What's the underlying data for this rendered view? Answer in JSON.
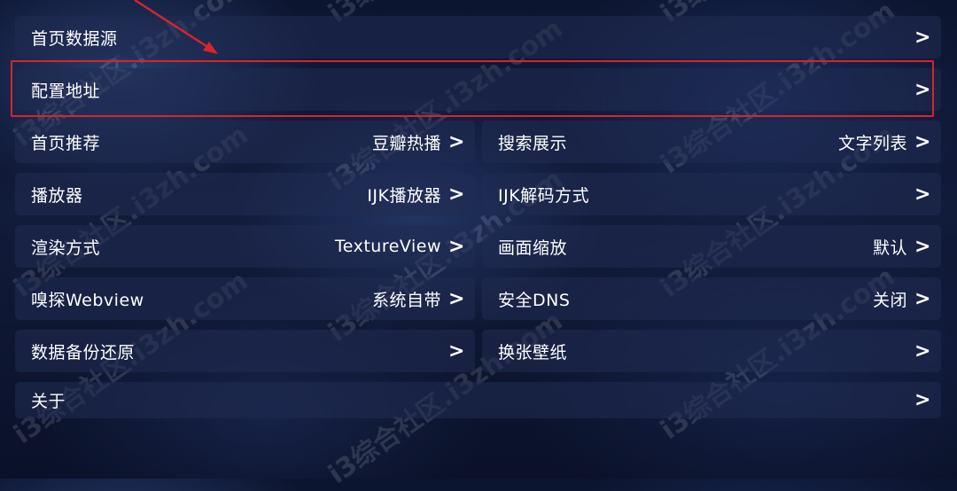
{
  "settings": {
    "rows": [
      {
        "label": "首页数据源",
        "value": "",
        "chevron": ">"
      },
      {
        "label": "配置地址",
        "value": "",
        "chevron": ">"
      }
    ],
    "grid": [
      {
        "label": "首页推荐",
        "value": "豆瓣热播",
        "chevron": ">"
      },
      {
        "label": "搜索展示",
        "value": "文字列表",
        "chevron": ">"
      },
      {
        "label": "播放器",
        "value": "IJK播放器",
        "chevron": ">"
      },
      {
        "label": "IJK解码方式",
        "value": "",
        "chevron": ">"
      },
      {
        "label": "渲染方式",
        "value": "TextureView",
        "chevron": ">"
      },
      {
        "label": "画面缩放",
        "value": "默认",
        "chevron": ">"
      },
      {
        "label": "嗅探Webview",
        "value": "系统自带",
        "chevron": ">"
      },
      {
        "label": "安全DNS",
        "value": "关闭",
        "chevron": ">"
      },
      {
        "label": "数据备份还原",
        "value": "",
        "chevron": ">"
      },
      {
        "label": "换张壁纸",
        "value": "",
        "chevron": ">"
      }
    ],
    "about": {
      "label": "关于",
      "value": "",
      "chevron": ">"
    }
  },
  "annotation": {
    "color": "#d6252b"
  },
  "watermark": {
    "text": "i3综合社区.i3zh.com"
  }
}
